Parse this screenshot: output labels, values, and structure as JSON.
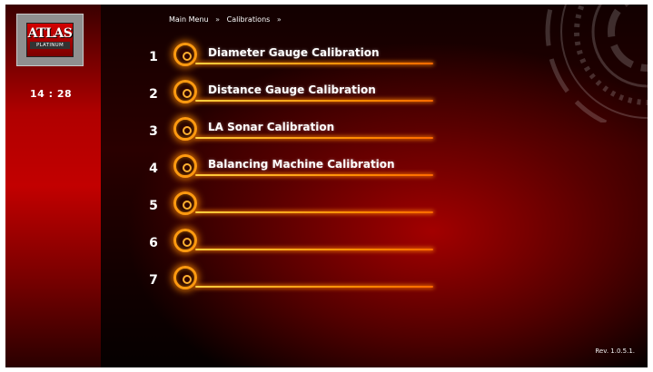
{
  "logo": {
    "brand": "ATLAS",
    "sub": "PLATINUM"
  },
  "clock": "14 : 28",
  "breadcrumb": {
    "items": [
      "Main Menu",
      "Calibrations"
    ],
    "separator": "»"
  },
  "menu": {
    "items": [
      {
        "number": "1",
        "label": "Diameter Gauge Calibration"
      },
      {
        "number": "2",
        "label": "Distance Gauge Calibration"
      },
      {
        "number": "3",
        "label": "LA Sonar Calibration"
      },
      {
        "number": "4",
        "label": "Balancing Machine Calibration"
      },
      {
        "number": "5",
        "label": ""
      },
      {
        "number": "6",
        "label": ""
      },
      {
        "number": "7",
        "label": ""
      }
    ]
  },
  "revision": "Rev. 1.0.5.1.",
  "colors": {
    "accent": "#ff9a10",
    "sidebar": "#c20000",
    "background": "#1a0000"
  }
}
